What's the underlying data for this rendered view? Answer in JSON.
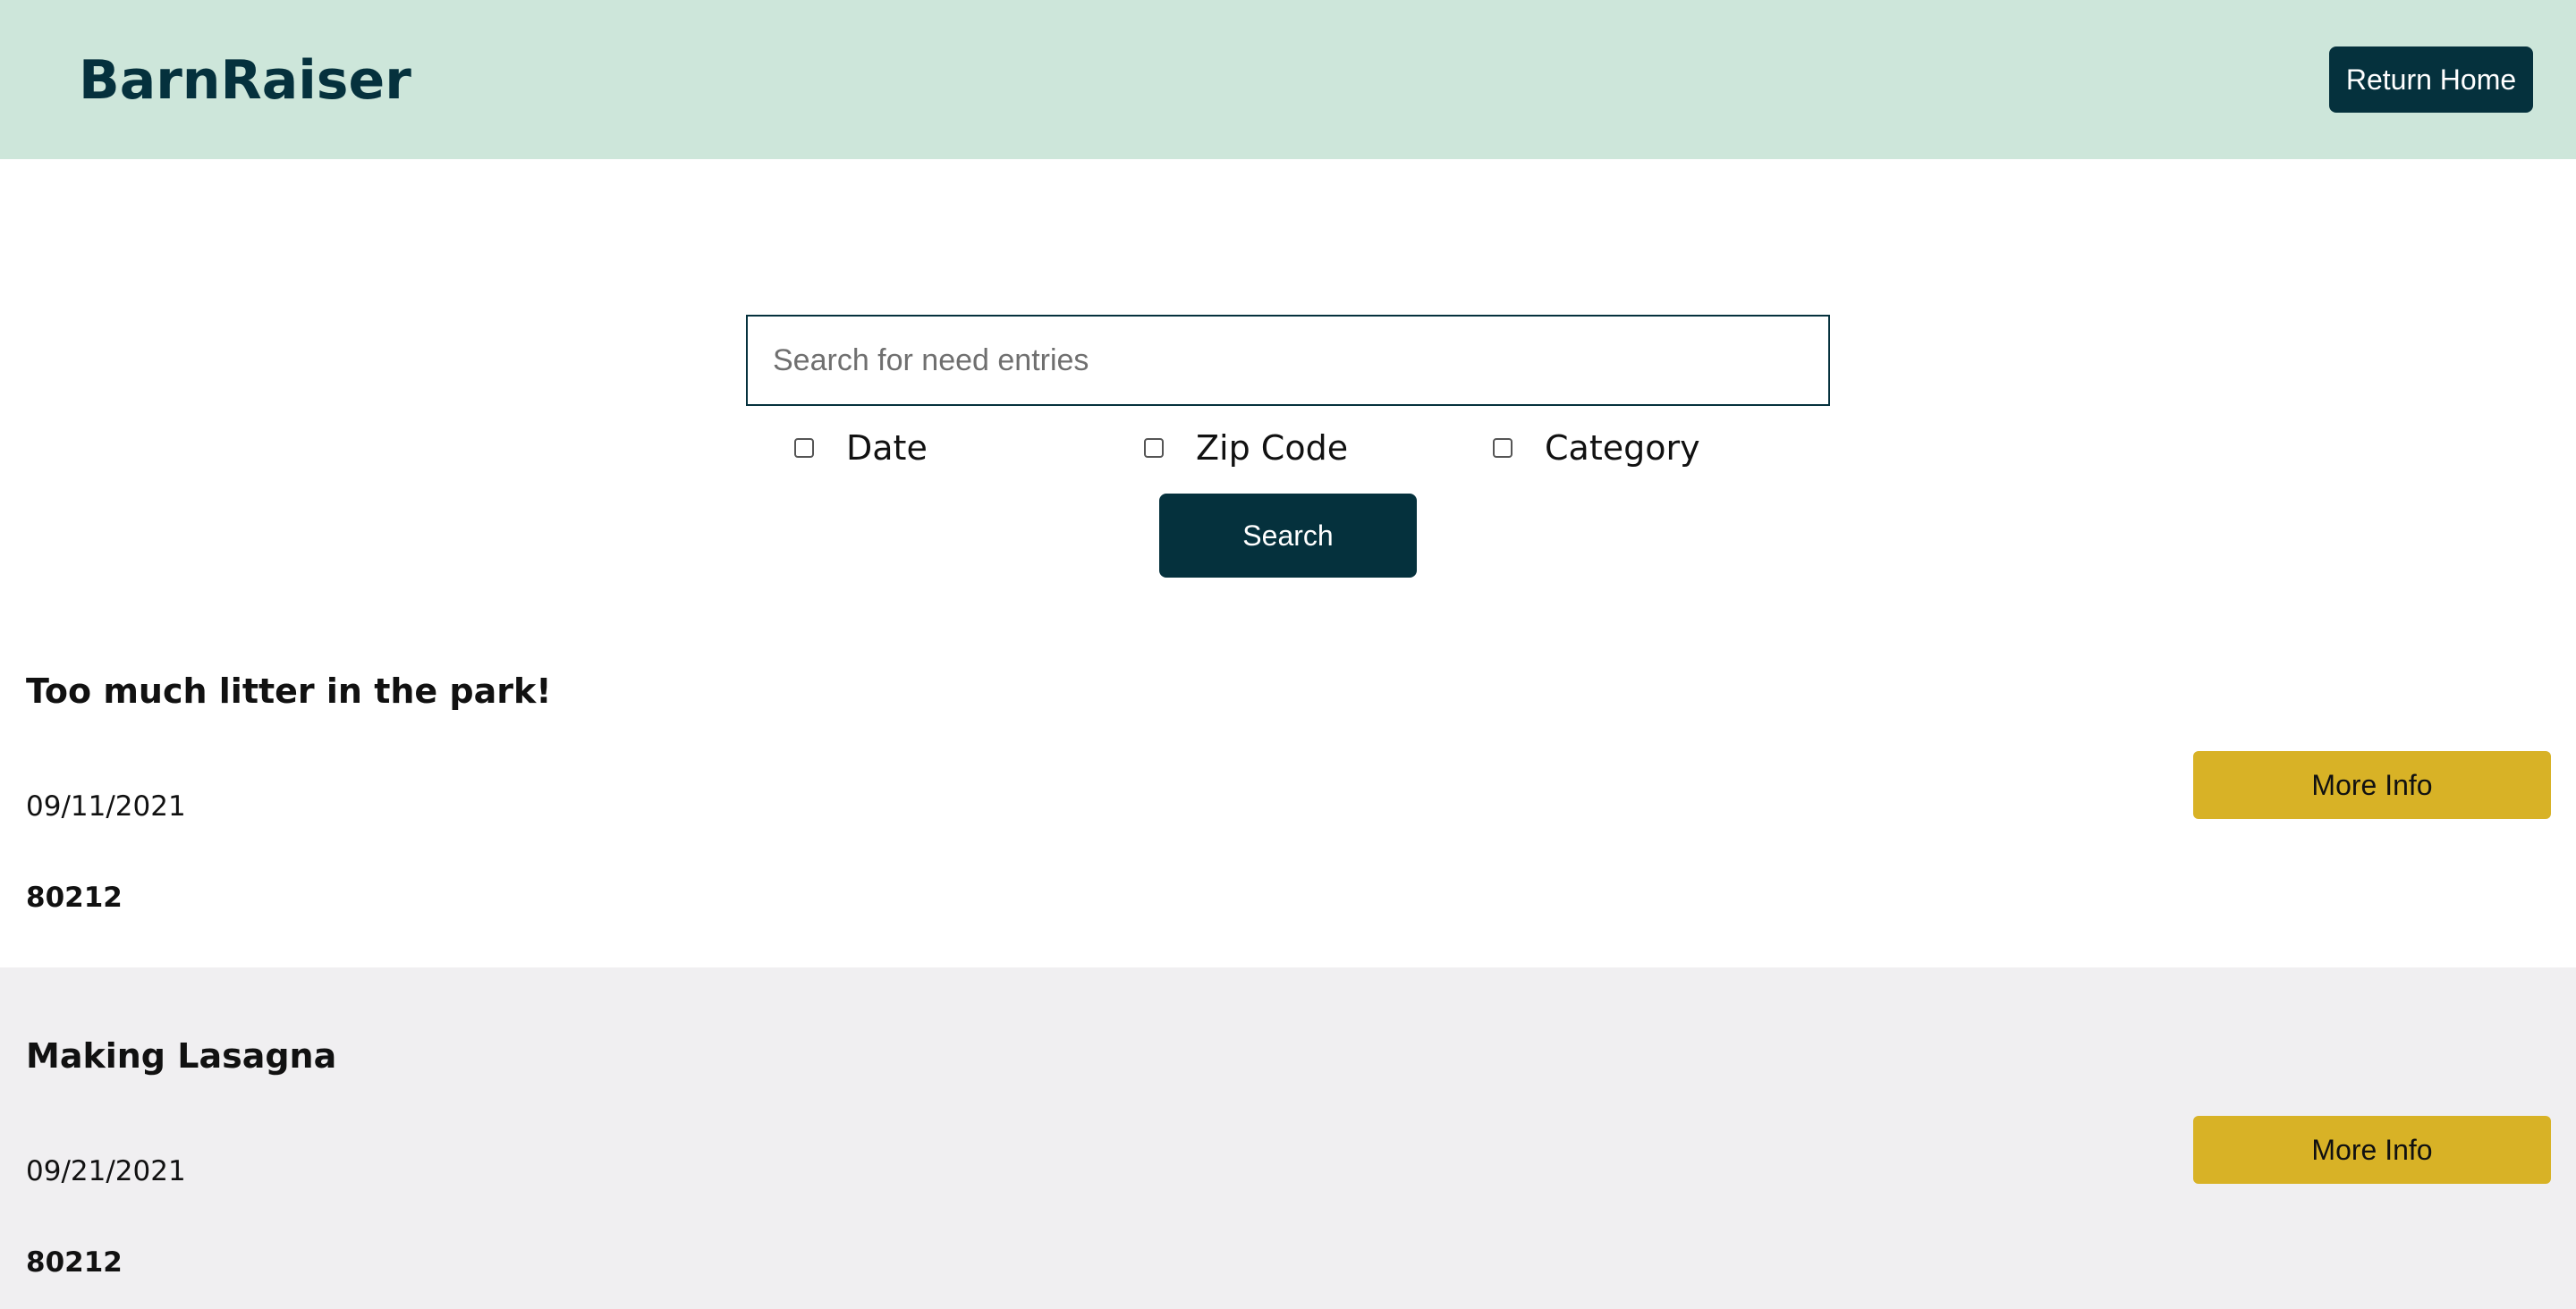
{
  "header": {
    "brand": "BarnRaiser",
    "return_home_label": "Return Home"
  },
  "search": {
    "placeholder": "Search for need entries",
    "value": "",
    "filters": [
      {
        "label": "Date",
        "checked": false
      },
      {
        "label": "Zip Code",
        "checked": false
      },
      {
        "label": "Category",
        "checked": false
      }
    ],
    "button_label": "Search"
  },
  "entries": [
    {
      "title": "Too much litter in the park!",
      "date": "09/11/2021",
      "zip": "80212",
      "button_label": "More Info"
    },
    {
      "title": "Making Lasagna",
      "date": "09/21/2021",
      "zip": "80212",
      "button_label": "More Info"
    }
  ],
  "colors": {
    "header_bg": "#cde6da",
    "brand": "#05313d",
    "primary_button": "#05313d",
    "more_info_button": "#d8b226",
    "alt_row_bg": "#f0eff1"
  }
}
